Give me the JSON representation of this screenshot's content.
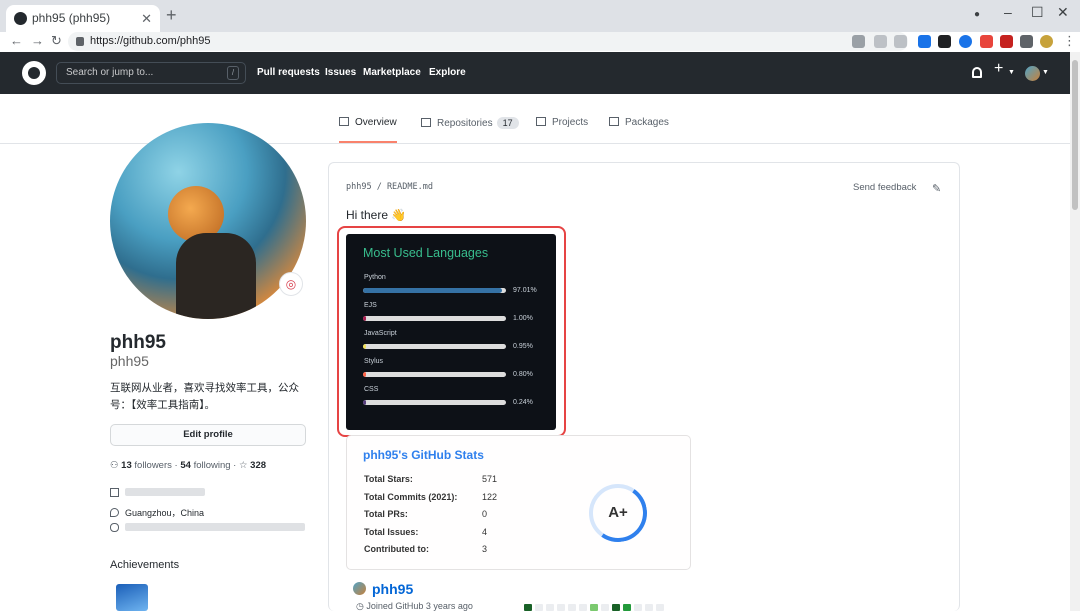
{
  "browser": {
    "tab_title": "phh95 (phh95)",
    "url": "https://github.com/phh95"
  },
  "header": {
    "search_placeholder": "Search or jump to...",
    "search_key": "/",
    "nav": [
      "Pull requests",
      "Issues",
      "Marketplace",
      "Explore"
    ]
  },
  "profile_tabs": [
    {
      "label": "Overview"
    },
    {
      "label": "Repositories",
      "count": "17"
    },
    {
      "label": "Projects"
    },
    {
      "label": "Packages"
    }
  ],
  "profile": {
    "name": "phh95",
    "login": "phh95",
    "bio": "互联网从业者，喜欢寻找效率工具，公众号：【效率工具指南】。",
    "edit_label": "Edit profile",
    "followers_count": "13",
    "followers_label": "followers",
    "following_count": "54",
    "following_label": "following",
    "stars_count": "328",
    "location": "Guangzhou，China",
    "achievements_label": "Achievements"
  },
  "readme": {
    "path": "phh95 / README.md",
    "feedback": "Send feedback",
    "greeting": "Hi there 👋"
  },
  "languages_card": {
    "title": "Most Used Languages",
    "items": [
      {
        "name": "Python",
        "percent": "97.01%",
        "value": 97.01,
        "color": "#3572A5"
      },
      {
        "name": "EJS",
        "percent": "1.00%",
        "value": 1.0,
        "color": "#a91e50"
      },
      {
        "name": "JavaScript",
        "percent": "0.95%",
        "value": 0.95,
        "color": "#f1e05a"
      },
      {
        "name": "Stylus",
        "percent": "0.80%",
        "value": 0.8,
        "color": "#ff6347"
      },
      {
        "name": "CSS",
        "percent": "0.24%",
        "value": 0.24,
        "color": "#563d7c"
      }
    ]
  },
  "stats_card": {
    "title": "phh95's GitHub Stats",
    "rows": [
      {
        "label": "Total Stars:",
        "value": "571"
      },
      {
        "label": "Total Commits (2021):",
        "value": "122"
      },
      {
        "label": "Total PRs:",
        "value": "0"
      },
      {
        "label": "Total Issues:",
        "value": "4"
      },
      {
        "label": "Contributed to:",
        "value": "3"
      }
    ],
    "grade": "A+"
  },
  "trophy": {
    "name": "phh95",
    "joined": "Joined GitHub 3 years ago"
  },
  "colors": {
    "header_bg": "#24292e",
    "accent_tab": "#f9826c",
    "link": "#0366d6",
    "card_title": "#38bd8d",
    "highlight": "#e64444"
  }
}
